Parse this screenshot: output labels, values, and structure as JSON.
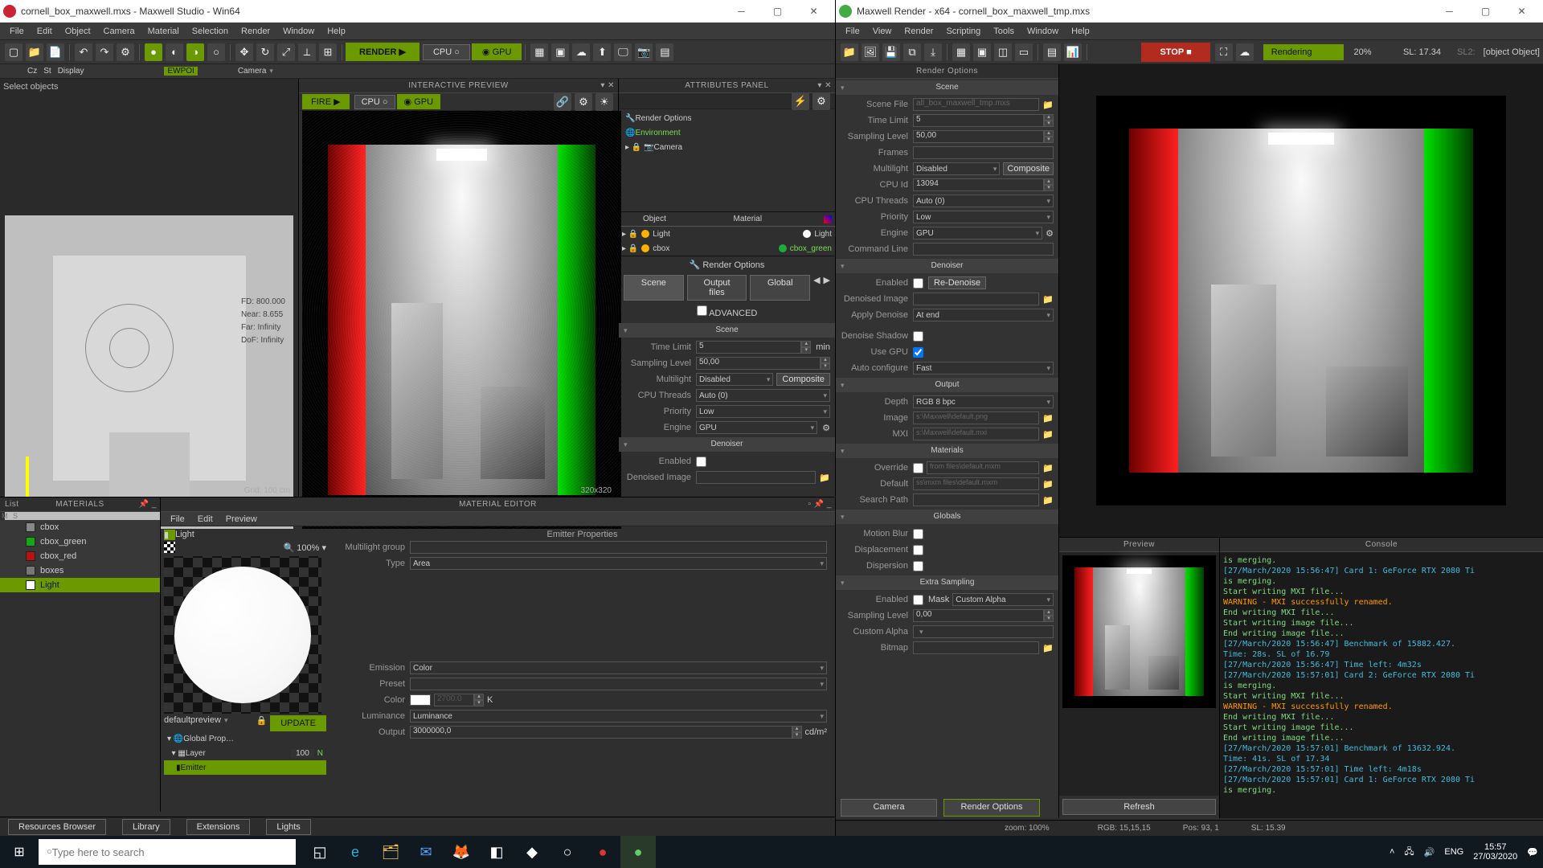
{
  "studio": {
    "title": "cornell_box_maxwell.mxs  -  Maxwell Studio  -  Win64",
    "menu": [
      "File",
      "Edit",
      "Object",
      "Camera",
      "Material",
      "Selection",
      "Render",
      "Window",
      "Help"
    ],
    "toolbar": {
      "render_label": "RENDER",
      "cpu_label": "CPU",
      "gpu_label": "GPU"
    },
    "subbar": {
      "ewpoi": "EWPOI",
      "camera": "Camera"
    },
    "interactive": {
      "title": "INTERACTIVE PREVIEW",
      "fire_label": "FIRE",
      "cpu_label": "CPU",
      "gpu_label": "GPU",
      "res": "320x320"
    },
    "viewport": {
      "select": "Select objects",
      "fd": "FD: 800.000",
      "near": "Near: 8.655",
      "far": "Far: Infinity",
      "dof": "DoF: Infinity",
      "grid": "Grid: 100 cm"
    },
    "materials_panel": {
      "list_label": "List",
      "header": "MATERIALS",
      "items": [
        "cbox",
        "cbox_green",
        "cbox_red",
        "boxes",
        "Light"
      ],
      "columns": [
        "M",
        "S"
      ]
    },
    "material_editor": {
      "title": "MATERIAL EDITOR",
      "menu": [
        "File",
        "Edit",
        "Preview"
      ],
      "name": "Light",
      "zoom": "100%",
      "preview_mode": "defaultpreview",
      "update": "UPDATE",
      "tree": {
        "global": "Global Prop…",
        "layer": "Layer",
        "layer_val": "100",
        "layer_n": "N",
        "emitter": "Emitter"
      },
      "emitter": {
        "title": "Emitter Properties",
        "multilight": "Multilight group",
        "type_label": "Type",
        "type": "Area",
        "emission_label": "Emission",
        "emission": "Color",
        "preset_label": "Preset",
        "preset": "",
        "color_label": "Color",
        "colork": "2700.0",
        "k": "K",
        "luminance_label": "Luminance",
        "luminance": "Luminance",
        "output_label": "Output",
        "output": "3000000,0",
        "output_unit": "cd/m²"
      }
    },
    "attributes": {
      "title": "ATTRIBUTES PANEL",
      "render_options": "Render Options",
      "environment": "Environment",
      "camera": "Camera",
      "columns": {
        "object": "Object",
        "material": "Material"
      },
      "rows": [
        {
          "obj": "Light",
          "mat": "Light"
        },
        {
          "obj": "cbox",
          "mat": "cbox_green"
        }
      ]
    },
    "render_opts": {
      "title": "Render Options",
      "tabs": {
        "scene": "Scene",
        "output": "Output files",
        "global": "Global"
      },
      "advanced": "ADVANCED",
      "scene_header": "Scene",
      "time_limit": "Time Limit",
      "time_limit_v": "5",
      "time_limit_u": "min",
      "sampling": "Sampling Level",
      "sampling_v": "50,00",
      "multilight": "Multilight",
      "multilight_v": "Disabled",
      "composite": "Composite",
      "cpu_threads": "CPU Threads",
      "cpu_threads_v": "Auto (0)",
      "priority": "Priority",
      "priority_v": "Low",
      "engine": "Engine",
      "engine_v": "GPU",
      "denoiser_header": "Denoiser",
      "enabled": "Enabled",
      "denoised": "Denoised Image"
    },
    "bottom_tabs": [
      "Resources Browser",
      "Library",
      "Extensions",
      "Lights"
    ],
    "footer": {
      "camera": "Camera",
      "render_options": "Render Options"
    }
  },
  "render": {
    "title": "Maxwell Render  - x64  -  cornell_box_maxwell_tmp.mxs",
    "menu": [
      "File",
      "View",
      "Render",
      "Scripting",
      "Tools",
      "Window",
      "Help"
    ],
    "stop": "STOP",
    "rendering": "Rendering",
    "progress": "20%",
    "sl1": "SL: 17.34",
    "sl2": "SL2:",
    "extra": {
      "enabled": "Enabled",
      "mask": "Mask",
      "mask_v": "Custom Alpha",
      "sampling": "Sampling Level",
      "sampling_v": "0,00",
      "custom": "Custom Alpha",
      "bitmap": "Bitmap"
    },
    "panel_title": "Render Options",
    "sections": {
      "scene": "Scene",
      "denoiser": "Denoiser",
      "output": "Output",
      "materials": "Materials",
      "globals": "Globals",
      "extra": "Extra Sampling"
    },
    "scene": {
      "file": "Scene File",
      "file_v": "all_box_maxwell_tmp.mxs",
      "time": "Time Limit",
      "time_v": "5",
      "sampling": "Sampling Level",
      "sampling_v": "50,00",
      "frames": "Frames",
      "multi": "Multilight",
      "multi_v": "Disabled",
      "composite": "Composite",
      "cpuid": "CPU Id",
      "cpuid_v": "13094",
      "cputh": "CPU Threads",
      "cputh_v": "Auto (0)",
      "priority": "Priority",
      "priority_v": "Low",
      "engine": "Engine",
      "engine_v": "GPU",
      "cmd": "Command Line"
    },
    "denoiser": {
      "enabled": "Enabled",
      "redenoise": "Re-Denoise",
      "denoised": "Denoised Image",
      "apply": "Apply Denoise",
      "apply_v": "At end",
      "shadow": "Denoise Shadow",
      "gpu": "Use GPU",
      "auto": "Auto configure",
      "auto_v": "Fast"
    },
    "output": {
      "depth": "Depth",
      "depth_v": "RGB  8 bpc",
      "image": "Image",
      "image_v": "s:\\Maxwell\\default.png",
      "mxi": "MXI",
      "mxi_v": "s:\\Maxwell\\default.mxi"
    },
    "materials": {
      "override": "Override",
      "override_v": "from files\\default.mxm",
      "default": "Default",
      "default_v": "ss\\mxm files\\default.mxm",
      "search": "Search Path"
    },
    "globals": {
      "mblur": "Motion Blur",
      "disp": "Displacement",
      "dispersion": "Dispersion"
    },
    "preview": "Preview",
    "refresh": "Refresh",
    "console_title": "Console",
    "console_lines": [
      {
        "c": "g",
        "t": "is merging."
      },
      {
        "c": "c",
        "t": "[27/March/2020 15:56:47] Card 1: GeForce RTX 2080 Ti"
      },
      {
        "c": "g",
        "t": "is merging."
      },
      {
        "c": "g",
        "t": "Start writing MXI file..."
      },
      {
        "c": "o",
        "t": "WARNING - MXI successfully renamed."
      },
      {
        "c": "g",
        "t": "End writing MXI file..."
      },
      {
        "c": "g",
        "t": "Start writing image file..."
      },
      {
        "c": "g",
        "t": "End writing image file..."
      },
      {
        "c": "c",
        "t": "[27/March/2020 15:56:47] Benchmark of 15882.427."
      },
      {
        "c": "c",
        "t": "Time: 28s. SL of 16.79"
      },
      {
        "c": "c",
        "t": "[27/March/2020 15:56:47] Time left: 4m32s"
      },
      {
        "c": "c",
        "t": "[27/March/2020 15:57:01] Card 2: GeForce RTX 2080 Ti"
      },
      {
        "c": "g",
        "t": "is merging."
      },
      {
        "c": "g",
        "t": "Start writing MXI file..."
      },
      {
        "c": "o",
        "t": "WARNING - MXI successfully renamed."
      },
      {
        "c": "g",
        "t": "End writing MXI file..."
      },
      {
        "c": "g",
        "t": "Start writing image file..."
      },
      {
        "c": "g",
        "t": "End writing image file..."
      },
      {
        "c": "c",
        "t": "[27/March/2020 15:57:01] Benchmark of 13632.924."
      },
      {
        "c": "c",
        "t": "Time: 41s. SL of 17.34"
      },
      {
        "c": "c",
        "t": "[27/March/2020 15:57:01] Time left: 4m18s"
      },
      {
        "c": "c",
        "t": "[27/March/2020 15:57:01] Card 1: GeForce RTX 2080 Ti"
      },
      {
        "c": "g",
        "t": "is merging."
      }
    ],
    "statusbar": {
      "zoom": "zoom: 100%",
      "rgb": "RGB: 15,15,15",
      "pos": "Pos: 93, 1",
      "sl": "SL: 15.39"
    }
  },
  "taskbar": {
    "search_placeholder": "Type here to search",
    "lang": "ENG",
    "time": "15:57",
    "date": "27/03/2020"
  }
}
